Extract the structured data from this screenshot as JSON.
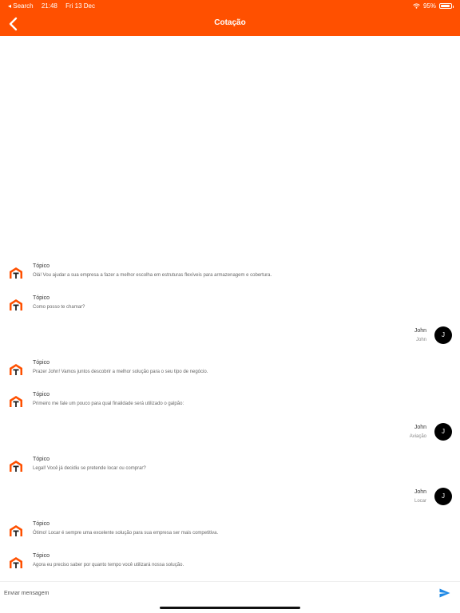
{
  "status_bar": {
    "back_label": "◂ Search",
    "time": "21:48",
    "date": "Fri 13 Dec",
    "battery": "95%",
    "battery_level": 0.95
  },
  "header": {
    "title": "Cotação",
    "background": "#ff5000"
  },
  "messages": [
    {
      "sender": "bot",
      "name": "Tópico",
      "text": "Olá! Vou ajudar a sua empresa a fazer a melhor escolha em estruturas flexíveis para armazenagem e cobertura."
    },
    {
      "sender": "bot",
      "name": "Tópico",
      "text": "Como posso te chamar?"
    },
    {
      "sender": "user",
      "initial": "J",
      "name": "John",
      "text": "John"
    },
    {
      "sender": "bot",
      "name": "Tópico",
      "text": "Prazer John! Vamos juntos descobrir a melhor solução para o seu tipo de negócio."
    },
    {
      "sender": "bot",
      "name": "Tópico",
      "text": "Primeiro me fale um pouco para qual finalidade será utilizado o galpão:"
    },
    {
      "sender": "user",
      "initial": "J",
      "name": "John",
      "text": "Aviação"
    },
    {
      "sender": "bot",
      "name": "Tópico",
      "text": "Legal! Você já decidiu se pretende locar ou comprar?"
    },
    {
      "sender": "user",
      "initial": "J",
      "name": "John",
      "text": "Locar"
    },
    {
      "sender": "bot",
      "name": "Tópico",
      "text": "Ótimo! Locar é sempre uma excelente solução para sua empresa ser mais competitiva."
    },
    {
      "sender": "bot",
      "name": "Tópico",
      "text": "Agora eu preciso saber por quanto tempo você utilizará nossa solução."
    }
  ],
  "composer": {
    "placeholder": "Enviar mensagem",
    "value": ""
  }
}
